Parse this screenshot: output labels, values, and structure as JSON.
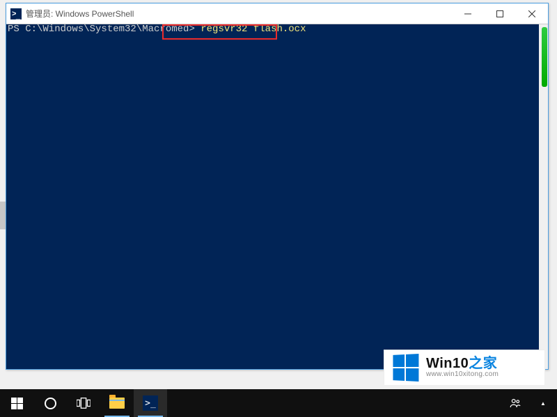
{
  "window": {
    "title": "管理员: Windows PowerShell"
  },
  "terminal": {
    "prompt": "PS C:\\Windows\\System32\\Macromed> ",
    "command": "regsvr32 flash.ocx"
  },
  "watermark": {
    "brand_main": "Win10",
    "brand_suffix": "之家",
    "url": "www.win10xitong.com"
  },
  "taskbar": {
    "start": "start",
    "cortana": "cortana",
    "taskview": "task-view",
    "file_explorer": "file-explorer",
    "powershell": "powershell",
    "people": "people",
    "tray_up": "show-hidden-icons"
  }
}
